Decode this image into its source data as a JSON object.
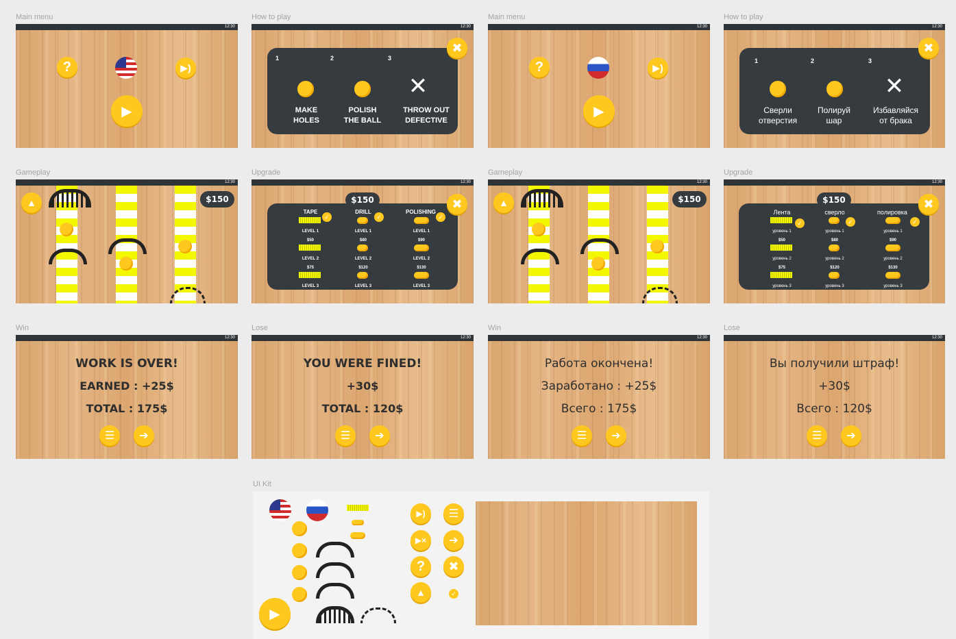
{
  "artboards": {
    "main_menu_en": "Main menu",
    "how_to_play_en": "How to play",
    "main_menu_ru": "Main menu",
    "how_to_play_ru": "How to play",
    "gameplay_en": "Gameplay",
    "upgrade_en": "Upgrade",
    "gameplay_ru": "Gameplay",
    "upgrade_ru": "Upgrade",
    "win_en": "Win",
    "lose_en": "Lose",
    "win_ru": "Win",
    "lose_ru": "Lose",
    "ui_kit": "UI Kit"
  },
  "status_time": "12:30",
  "how_to_play": {
    "en": {
      "steps": [
        "1",
        "2",
        "3"
      ],
      "step1": "MAKE\nHOLES",
      "step2": "POLISH\nTHE BALL",
      "step3": "THROW OUT\nDEFECTIVE"
    },
    "ru": {
      "steps": [
        "1",
        "2",
        "3"
      ],
      "step1": "Сверли\nотверстия",
      "step2": "Полируй\nшар",
      "step3": "Избавляйся\nот брака"
    }
  },
  "money": "$150",
  "upgrade": {
    "en": {
      "col1": "TAPE",
      "col2": "DRILL",
      "col3": "POLISHING",
      "level1": "LEVEL 1",
      "level2": "LEVEL 2",
      "level3": "LEVEL 3",
      "c1_p2": "$50",
      "c1_p3": "$75",
      "c2_p2": "$80",
      "c2_p3": "$120",
      "c3_p2": "$90",
      "c3_p3": "$130"
    },
    "ru": {
      "col1": "Лента",
      "col2": "сверло",
      "col3": "полировка",
      "level1": "уровень 1",
      "level2": "уровень 2",
      "level3": "уровень 3",
      "c1_p2": "$50",
      "c1_p3": "$75",
      "c2_p2": "$80",
      "c2_p3": "$120",
      "c3_p2": "$90",
      "c3_p3": "$130"
    }
  },
  "win_en": {
    "title": "WORK IS OVER!",
    "earned": "EARNED : +25$",
    "total": "TOTAL : 175$"
  },
  "lose_en": {
    "title": "YOU WERE FINED!",
    "fine": "+30$",
    "total": "TOTAL : 120$"
  },
  "win_ru": {
    "title": "Работа окончена!",
    "earned": "Заработано : +25$",
    "total": "Всего : 175$"
  },
  "lose_ru": {
    "title": "Вы получили штраф!",
    "fine": "+30$",
    "total": "Всего : 120$"
  },
  "icons": {
    "help": "?",
    "sound": "speaker",
    "close": "x",
    "menu": "hamburger",
    "next": "arrow-right",
    "check": "checkmark",
    "play": "play"
  },
  "colors": {
    "accent": "#ffc81f",
    "panel": "#353b3e",
    "tape": "#f3f700",
    "wood": "#dfae7a"
  }
}
